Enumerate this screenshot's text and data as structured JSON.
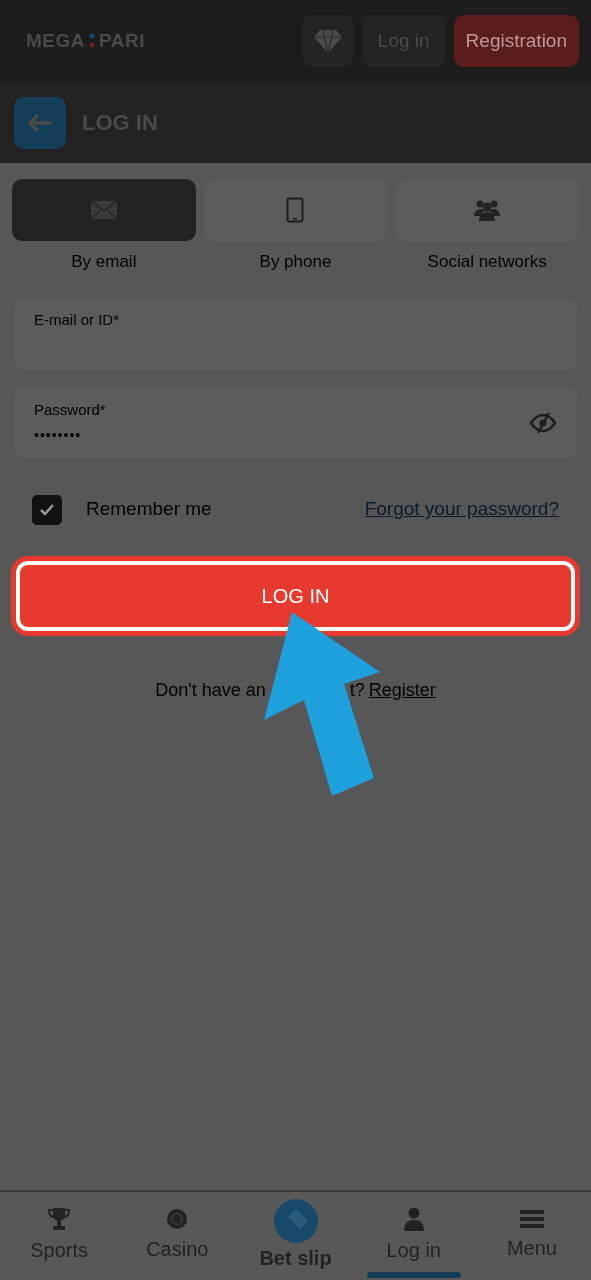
{
  "header": {
    "logo": {
      "left": "MEGA",
      "right": "PARI"
    },
    "login_button": "Log in",
    "register_button": "Registration"
  },
  "page_title": "LOG IN",
  "tabs": [
    {
      "label": "By email",
      "selected": true,
      "kind": "email"
    },
    {
      "label": "By phone",
      "selected": false,
      "kind": "phone"
    },
    {
      "label": "Social networks",
      "selected": false,
      "kind": "social"
    }
  ],
  "email_field": {
    "label": "E-mail or ID*"
  },
  "password_field": {
    "label": "Password*",
    "value": "••••••••"
  },
  "remember": {
    "label": "Remember me",
    "checked": true
  },
  "forgot_link": "Forgot your password?",
  "submit_button": "LOG IN",
  "signup": {
    "prompt_start": "Don't have an",
    "prompt_end": "t?",
    "link": "Register"
  },
  "bottom_nav": [
    {
      "label": "Sports",
      "kind": "trophy",
      "selected": false
    },
    {
      "label": "Casino",
      "kind": "chip",
      "selected": false
    },
    {
      "label": "Bet slip",
      "kind": "ticket",
      "selected": false
    },
    {
      "label": "Log in",
      "kind": "person",
      "selected": true
    },
    {
      "label": "Menu",
      "kind": "menu",
      "selected": false
    }
  ]
}
